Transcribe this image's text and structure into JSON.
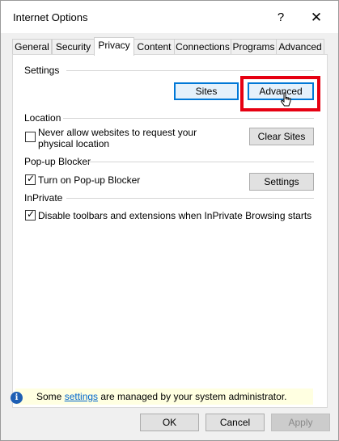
{
  "window": {
    "title": "Internet Options",
    "help": "?",
    "close": "✕"
  },
  "tabs": [
    {
      "label": "General"
    },
    {
      "label": "Security"
    },
    {
      "label": "Privacy"
    },
    {
      "label": "Content"
    },
    {
      "label": "Connections"
    },
    {
      "label": "Programs"
    },
    {
      "label": "Advanced"
    }
  ],
  "active_tab": "Privacy",
  "settings": {
    "label": "Settings",
    "sites_button": "Sites",
    "advanced_button": "Advanced"
  },
  "location": {
    "label": "Location",
    "checkbox_line1": "Never allow websites to request your",
    "checkbox_line2": "physical location",
    "checked": false,
    "clear_sites_button": "Clear Sites"
  },
  "popup": {
    "label": "Pop-up Blocker",
    "checkbox": "Turn on Pop-up Blocker",
    "checked": true,
    "settings_button": "Settings"
  },
  "inprivate": {
    "label": "InPrivate",
    "checkbox": "Disable toolbars and extensions when InPrivate Browsing starts",
    "checked": true
  },
  "info": {
    "icon": "i",
    "prefix": "Some ",
    "link": "settings",
    "suffix": " are managed by your system administrator."
  },
  "footer": {
    "ok": "OK",
    "cancel": "Cancel",
    "apply": "Apply"
  },
  "colors": {
    "highlight": "#e60012",
    "link": "#0066cc",
    "focus": "#0078d7"
  }
}
